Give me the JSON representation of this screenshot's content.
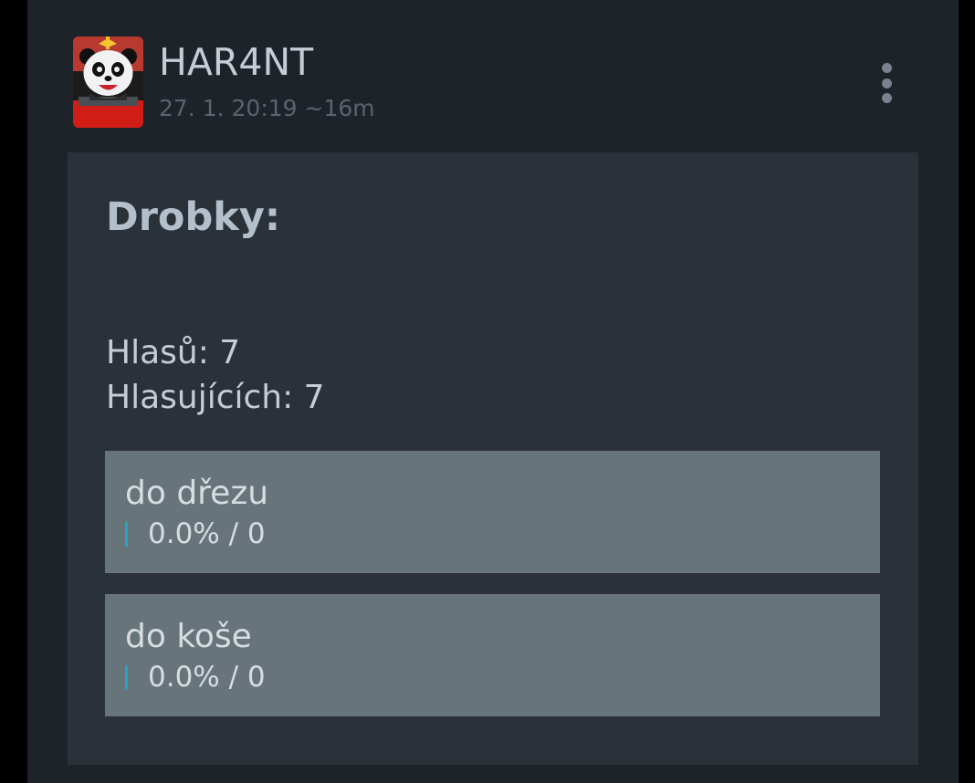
{
  "post": {
    "author": "HAR4NT",
    "timestamp": "27. 1. 20:19 ~16m",
    "avatar_icon": "panda-avatar-icon",
    "more_icon": "more-vertical-icon"
  },
  "poll": {
    "title": "Drobky:",
    "votes_text": "Hlasů: 7",
    "voters_text": "Hlasujících: 7",
    "options": [
      {
        "label": "do dřezu",
        "result": "0.0% / 0",
        "percent": 0.0,
        "count": 0
      },
      {
        "label": "do koše",
        "result": "0.0% / 0",
        "percent": 0.0,
        "count": 0
      }
    ]
  },
  "colors": {
    "background": "#1e2229",
    "card": "#2b3139",
    "option": "#67747a",
    "accent_bar": "#27a2c4",
    "author_text": "#c5ccd6",
    "muted_text": "#5b6370"
  }
}
